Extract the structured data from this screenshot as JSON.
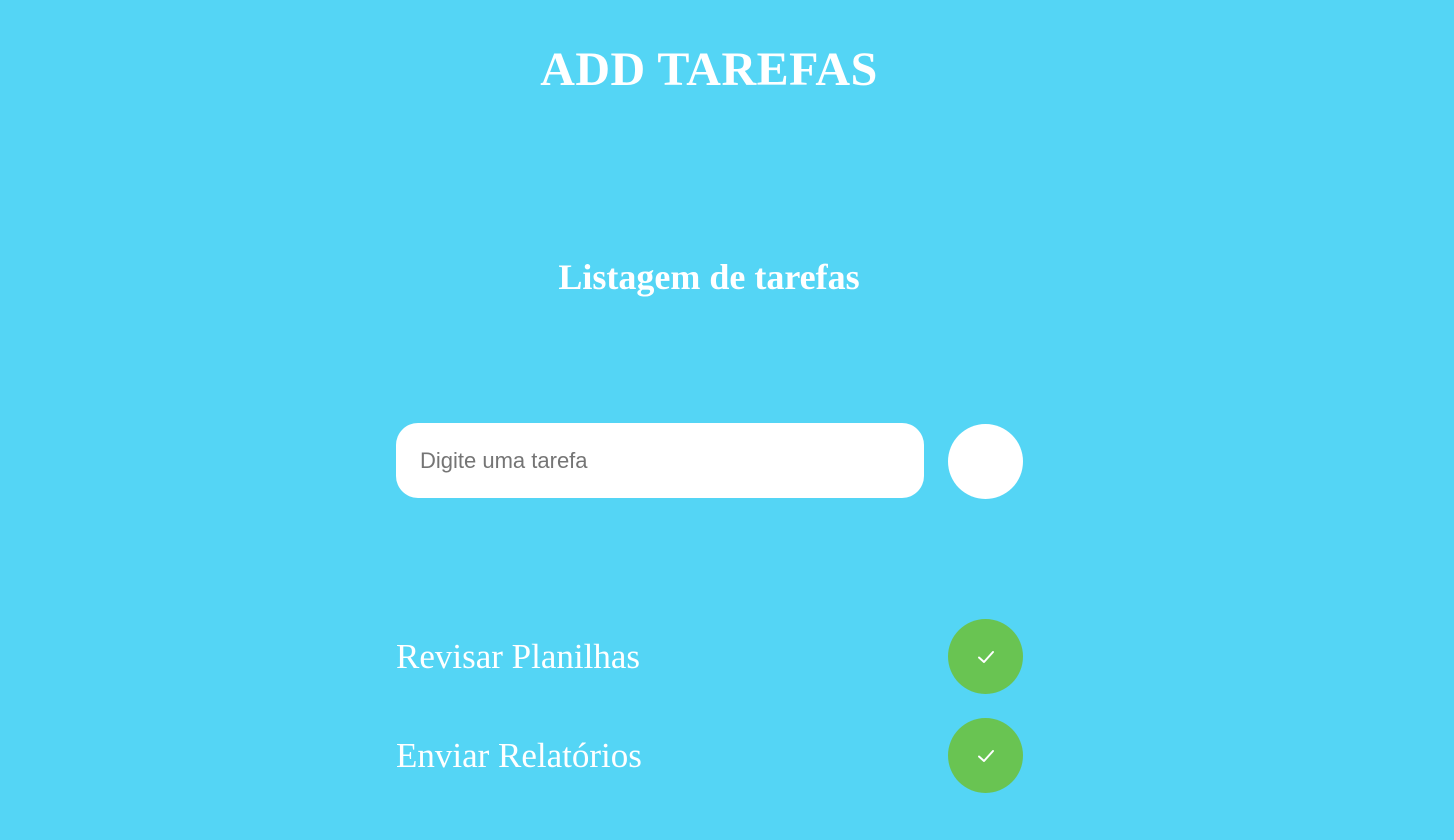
{
  "header": {
    "title": "ADD TAREFAS"
  },
  "section": {
    "title": "Listagem de tarefas"
  },
  "form": {
    "input_value": "",
    "placeholder": "Digite uma tarefa",
    "add_button_label": ""
  },
  "tasks": [
    {
      "label": "Revisar Planilhas",
      "action_icon": "check-icon"
    },
    {
      "label": "Enviar Relatórios",
      "action_icon": "check-icon"
    }
  ],
  "colors": {
    "background": "#54d5f5",
    "text": "#ffffff",
    "input_background": "#ffffff",
    "add_button": "#ffffff",
    "done_button": "#69c452"
  }
}
